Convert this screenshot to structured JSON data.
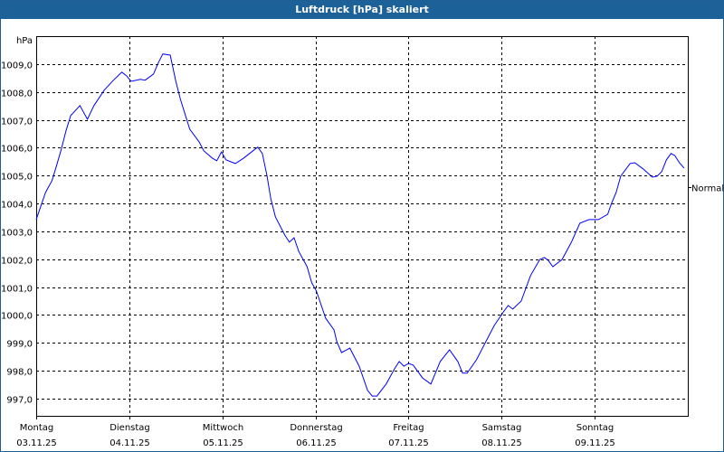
{
  "window": {
    "title": "Luftdruck [hPa] skaliert"
  },
  "chart_data": {
    "type": "line",
    "title": "Luftdruck [hPa] skaliert",
    "ylabel": "hPa",
    "xlabel": "",
    "ylim": [
      996.38,
      1010.0
    ],
    "xlim": [
      0,
      7
    ],
    "grid": true,
    "colors": {
      "series": "#0000ff",
      "grid": "#000000",
      "title_bar": "#1d6199"
    },
    "yticks": [
      997,
      998,
      999,
      1000,
      1001,
      1002,
      1003,
      1004,
      1005,
      1006,
      1007,
      1008,
      1009
    ],
    "ytick_labels": [
      "997,0",
      "998,0",
      "999,0",
      "1000,0",
      "1001,0",
      "1002,0",
      "1003,0",
      "1004,0",
      "1005,0",
      "1006,0",
      "1007,0",
      "1008,0",
      "1009,0"
    ],
    "xticks": [
      {
        "day": "Montag",
        "date": "03.11.25"
      },
      {
        "day": "Dienstag",
        "date": "04.11.25"
      },
      {
        "day": "Mittwoch",
        "date": "05.11.25"
      },
      {
        "day": "Donnerstag",
        "date": "06.11.25"
      },
      {
        "day": "Freitag",
        "date": "07.11.25"
      },
      {
        "day": "Samstag",
        "date": "08.11.25"
      },
      {
        "day": "Sonntag",
        "date": "09.11.25"
      }
    ],
    "reference": {
      "label": "Normal",
      "value": 1004.6
    },
    "series": [
      {
        "x": [
          0,
          0.1,
          0.17,
          0.22,
          0.27,
          0.32,
          0.37,
          0.47,
          0.55,
          0.62,
          0.73,
          0.83,
          0.92,
          0.97,
          1.02,
          1.12,
          1.17,
          1.26,
          1.31,
          1.36,
          1.44,
          1.5,
          1.55,
          1.65,
          1.75,
          1.8,
          1.89,
          1.94,
          1.99,
          2.04,
          2.14,
          2.23,
          2.33,
          2.38,
          2.43,
          2.48,
          2.52,
          2.57,
          2.67,
          2.72,
          2.77,
          2.82,
          2.91,
          2.96,
          3.01,
          3.11,
          3.2,
          3.23,
          3.28,
          3.37,
          3.47,
          3.56,
          3.61,
          3.66,
          3.76,
          3.85,
          3.9,
          3.95,
          4.0,
          4.05,
          4.15,
          4.24,
          4.34,
          4.44,
          4.53,
          4.58,
          4.63,
          4.73,
          4.83,
          4.92,
          5.02,
          5.07,
          5.12,
          5.21,
          5.31,
          5.41,
          5.46,
          5.5,
          5.55,
          5.65,
          5.75,
          5.84,
          5.94,
          6.04,
          6.14,
          6.18,
          6.23,
          6.28,
          6.38,
          6.43,
          6.52,
          6.62,
          6.67,
          6.72,
          6.77,
          6.82,
          6.86,
          6.91,
          6.96
        ],
        "y": [
          1003.42,
          1004.39,
          1004.82,
          1005.37,
          1005.95,
          1006.6,
          1007.15,
          1007.51,
          1007.02,
          1007.51,
          1008.06,
          1008.42,
          1008.71,
          1008.58,
          1008.38,
          1008.45,
          1008.42,
          1008.64,
          1009.03,
          1009.36,
          1009.32,
          1008.38,
          1007.73,
          1006.66,
          1006.21,
          1005.89,
          1005.63,
          1005.53,
          1005.85,
          1005.56,
          1005.43,
          1005.63,
          1005.89,
          1006.02,
          1005.79,
          1004.98,
          1004.17,
          1003.52,
          1002.87,
          1002.61,
          1002.77,
          1002.28,
          1001.73,
          1001.15,
          1000.86,
          999.88,
          999.46,
          999.04,
          998.65,
          998.81,
          998.16,
          997.29,
          997.09,
          997.09,
          997.52,
          998.07,
          998.33,
          998.16,
          998.26,
          998.2,
          997.74,
          997.52,
          998.33,
          998.75,
          998.33,
          997.91,
          997.91,
          998.39,
          999.04,
          999.62,
          1000.11,
          1000.34,
          1000.21,
          1000.5,
          1001.41,
          1001.99,
          1002.06,
          1001.96,
          1001.73,
          1001.99,
          1002.61,
          1003.29,
          1003.42,
          1003.42,
          1003.61,
          1004.0,
          1004.39,
          1004.98,
          1005.43,
          1005.46,
          1005.24,
          1004.94,
          1004.98,
          1005.14,
          1005.56,
          1005.79,
          1005.72,
          1005.46,
          1005.27
        ]
      }
    ]
  }
}
